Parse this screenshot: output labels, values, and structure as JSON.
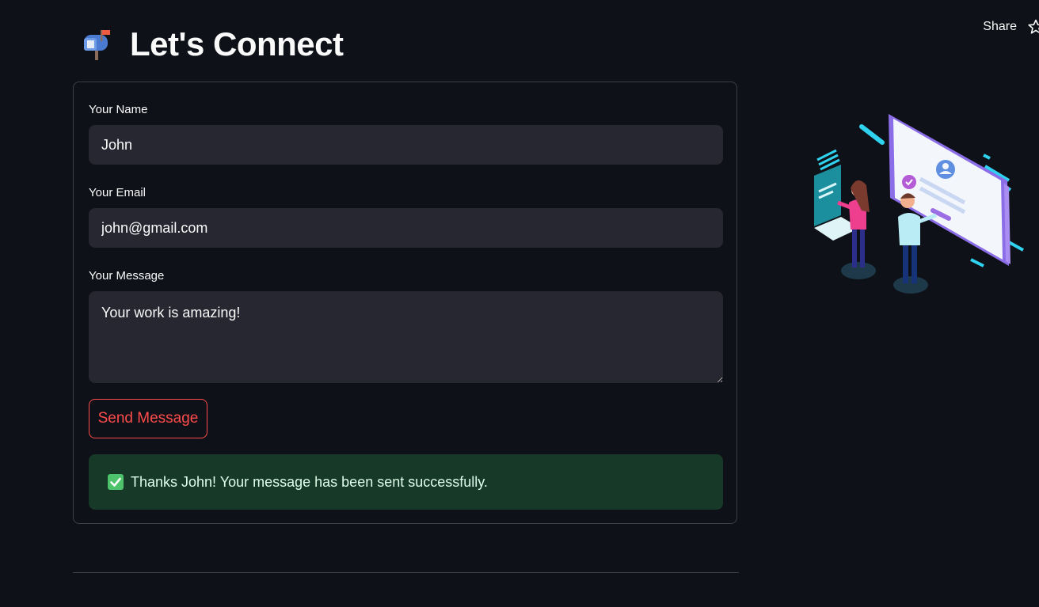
{
  "header": {
    "share_label": "Share",
    "star_icon": "star-icon"
  },
  "page": {
    "title_icon": "mailbox-icon",
    "title": "Let's Connect"
  },
  "form": {
    "name_label": "Your Name",
    "name_value": "John",
    "email_label": "Your Email",
    "email_value": "john@gmail.com",
    "message_label": "Your Message",
    "message_value": "Your work is amazing!",
    "submit_label": "Send Message"
  },
  "alert": {
    "icon": "check-icon",
    "text": "Thanks John! Your message has been sent successfully."
  },
  "colors": {
    "background": "#0e1117",
    "input_bg": "#262730",
    "accent": "#ff4b4b",
    "success_bg": "#173928"
  }
}
